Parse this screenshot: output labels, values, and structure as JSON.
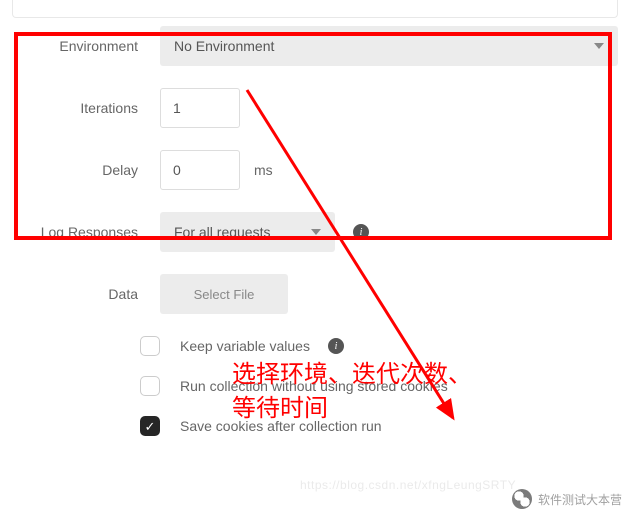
{
  "labels": {
    "environment": "Environment",
    "iterations": "Iterations",
    "delay": "Delay",
    "logResponses": "Log Responses",
    "data": "Data"
  },
  "values": {
    "environment": "No Environment",
    "iterations": "1",
    "delay": "0",
    "delayUnit": "ms",
    "logResponses": "For all requests",
    "selectFile": "Select File"
  },
  "checkboxes": {
    "keepVars": {
      "label": "Keep variable values",
      "checked": false,
      "info": true
    },
    "noCookies": {
      "label": "Run collection without using stored cookies",
      "checked": false,
      "info": false
    },
    "saveCookies": {
      "label": "Save cookies after collection run",
      "checked": true,
      "info": false
    }
  },
  "annotation": {
    "line1": "选择环境、迭代次数、",
    "line2": "等待时间"
  },
  "watermark": {
    "text": "软件测试大本营",
    "faint": "https://blog.csdn.net/xfngLeungSRTY"
  },
  "icons": {
    "info": "i",
    "check": "✓"
  }
}
